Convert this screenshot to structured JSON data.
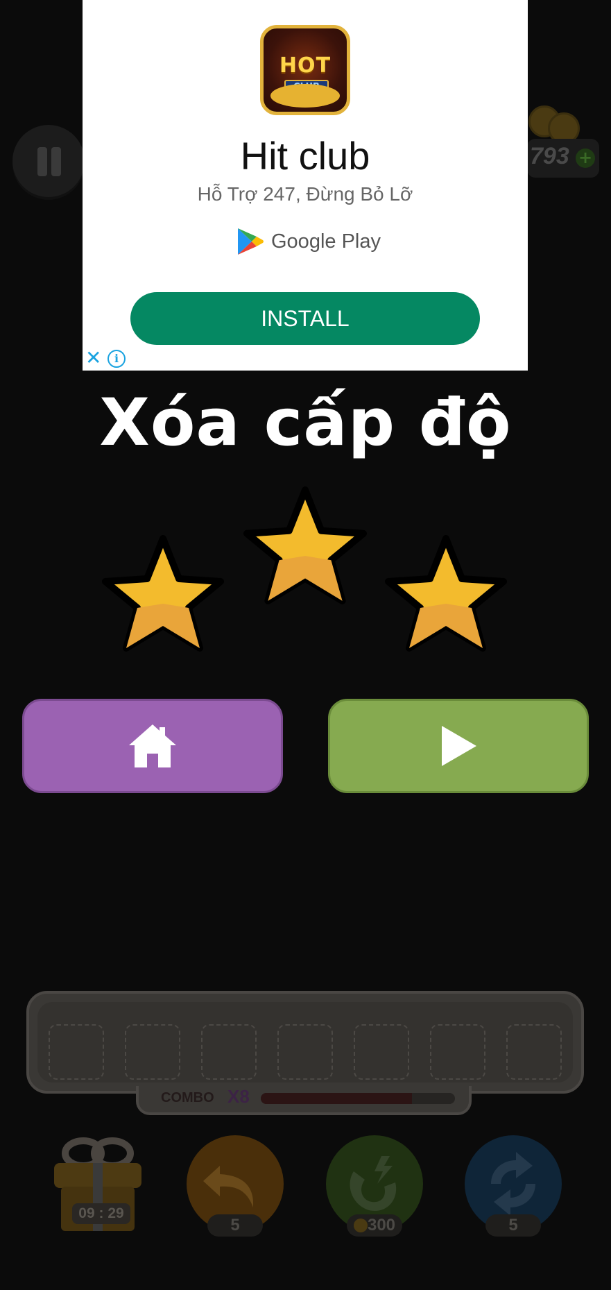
{
  "hud": {
    "coins_partial": "793",
    "coin_add_icon": "plus-icon",
    "pause_icon": "pause-icon"
  },
  "ad": {
    "app_name": "Hit club",
    "tagline": "Hỗ Trợ 247, Đừng Bỏ Lỡ",
    "store": "Google Play",
    "install_label": "INSTALL",
    "logo_word": "HOT",
    "logo_sub": "CLUB",
    "close_icon": "close-icon",
    "info_icon": "info-icon"
  },
  "result": {
    "title": "Xóa cấp độ",
    "stars_earned": 3,
    "stars_total": 3,
    "home_icon": "home-icon",
    "next_icon": "play-icon"
  },
  "tray": {
    "slots": 7,
    "combo_label": "COMBO",
    "combo_multiplier": "X8",
    "combo_progress": 0.78
  },
  "tools": {
    "gift_timer": "09 : 29",
    "undo_count": "5",
    "magnet_cost": "300",
    "shuffle_count": "5"
  },
  "colors": {
    "install": "#058862",
    "home_button": "#9b62b2",
    "next_button": "#86aa50",
    "star": "#f3bb2d"
  }
}
